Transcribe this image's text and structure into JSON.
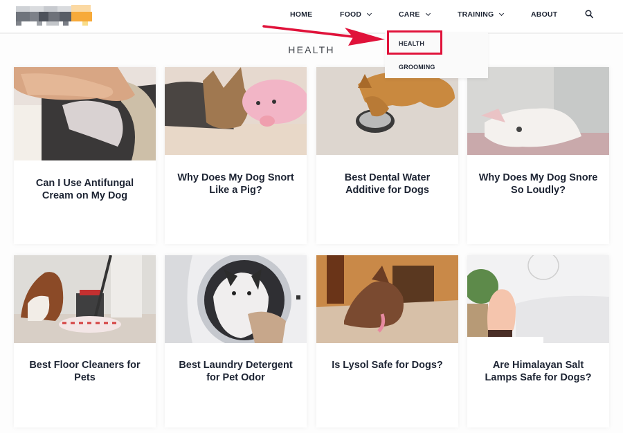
{
  "header": {
    "logo_alt": "site logo (pixelated)",
    "nav": [
      {
        "label": "HOME",
        "has_dropdown": false
      },
      {
        "label": "FOOD",
        "has_dropdown": true
      },
      {
        "label": "CARE",
        "has_dropdown": true
      },
      {
        "label": "TRAINING",
        "has_dropdown": true
      },
      {
        "label": "ABOUT",
        "has_dropdown": false
      }
    ],
    "search_icon": "search-icon"
  },
  "dropdown": {
    "parent": "CARE",
    "items": [
      {
        "label": "HEALTH",
        "highlighted": true
      },
      {
        "label": "GROOMING",
        "highlighted": false
      }
    ]
  },
  "annotation": {
    "arrow_color": "#e0123a",
    "box_color": "#e0123a",
    "points_to": "HEALTH"
  },
  "page": {
    "title": "HEALTH"
  },
  "posts": [
    {
      "title": "Can I Use Antifungal Cream on My Dog",
      "image": "hand on dog's ear"
    },
    {
      "title": "Why Does My Dog Snort Like a Pig?",
      "image": "yorkie with pink pig toy"
    },
    {
      "title": "Best Dental Water Additive for Dogs",
      "image": "corgi drinking from bowl"
    },
    {
      "title": "Why Does My Dog Snore So Loudly?",
      "image": "french bulldog sleeping on back"
    },
    {
      "title": "Best Floor Cleaners for Pets",
      "image": "dog and spin mop"
    },
    {
      "title": "Best Laundry Detergent for Pet Odor",
      "image": "french bulldog in washing machine"
    },
    {
      "title": "Is Lysol Safe for Dogs?",
      "image": "dog lying on tiled floor"
    },
    {
      "title": "Are Himalayan Salt Lamps Safe for Dogs?",
      "image": "salt lamp next to plant"
    }
  ],
  "colors": {
    "text": "#1d2433",
    "accent": "#e0123a",
    "logo_orange": "#f5a623"
  }
}
